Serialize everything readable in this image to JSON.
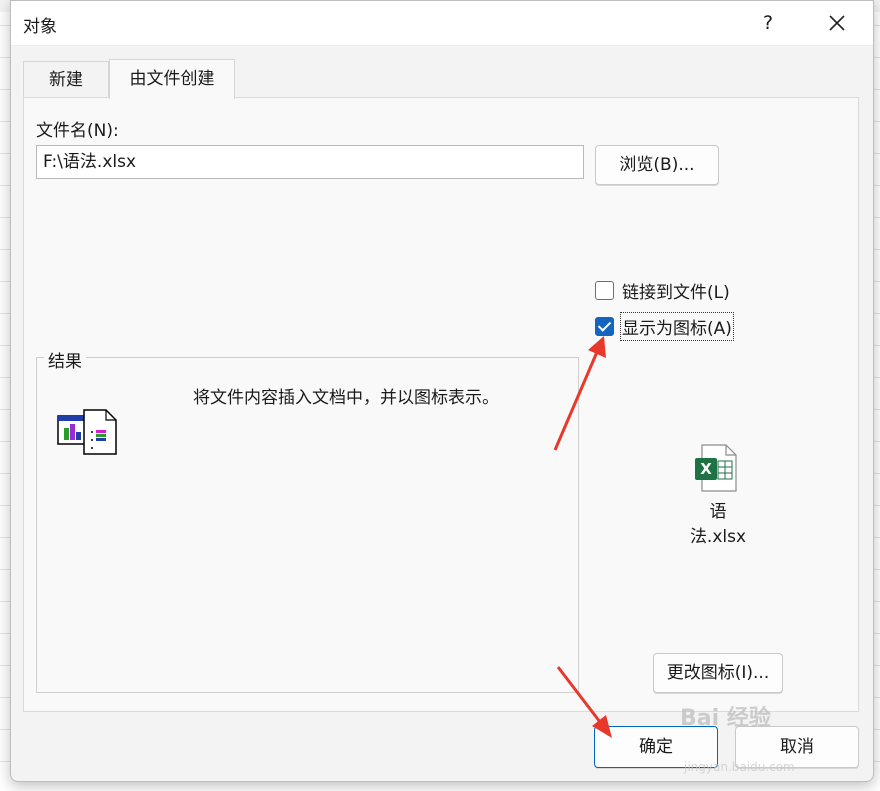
{
  "dialog": {
    "title": "对象",
    "help_label": "?"
  },
  "tabs": [
    {
      "label": "新建",
      "active": false
    },
    {
      "label": "由文件创建",
      "active": true
    }
  ],
  "file": {
    "label": "文件名(N):",
    "value": "F:\\语法.xlsx",
    "browse_label": "浏览(B)..."
  },
  "options": {
    "link_label": "链接到文件(L)",
    "link_checked": false,
    "display_icon_label": "显示为图标(A)",
    "display_icon_checked": true
  },
  "result": {
    "legend": "结果",
    "text": "将文件内容插入文档中，并以图标表示。"
  },
  "icon_preview": {
    "icon": "excel-file-icon",
    "caption": "语法.xlsx",
    "change_label": "更改图标(I)..."
  },
  "footer": {
    "ok_label": "确定",
    "cancel_label": "取消"
  },
  "watermark": {
    "text": "Bai 经验",
    "sub": "jingyan.baidu.com"
  },
  "colors": {
    "accent": "#1565c0",
    "arrow": "#e8382c",
    "excel_green": "#1f7244"
  }
}
